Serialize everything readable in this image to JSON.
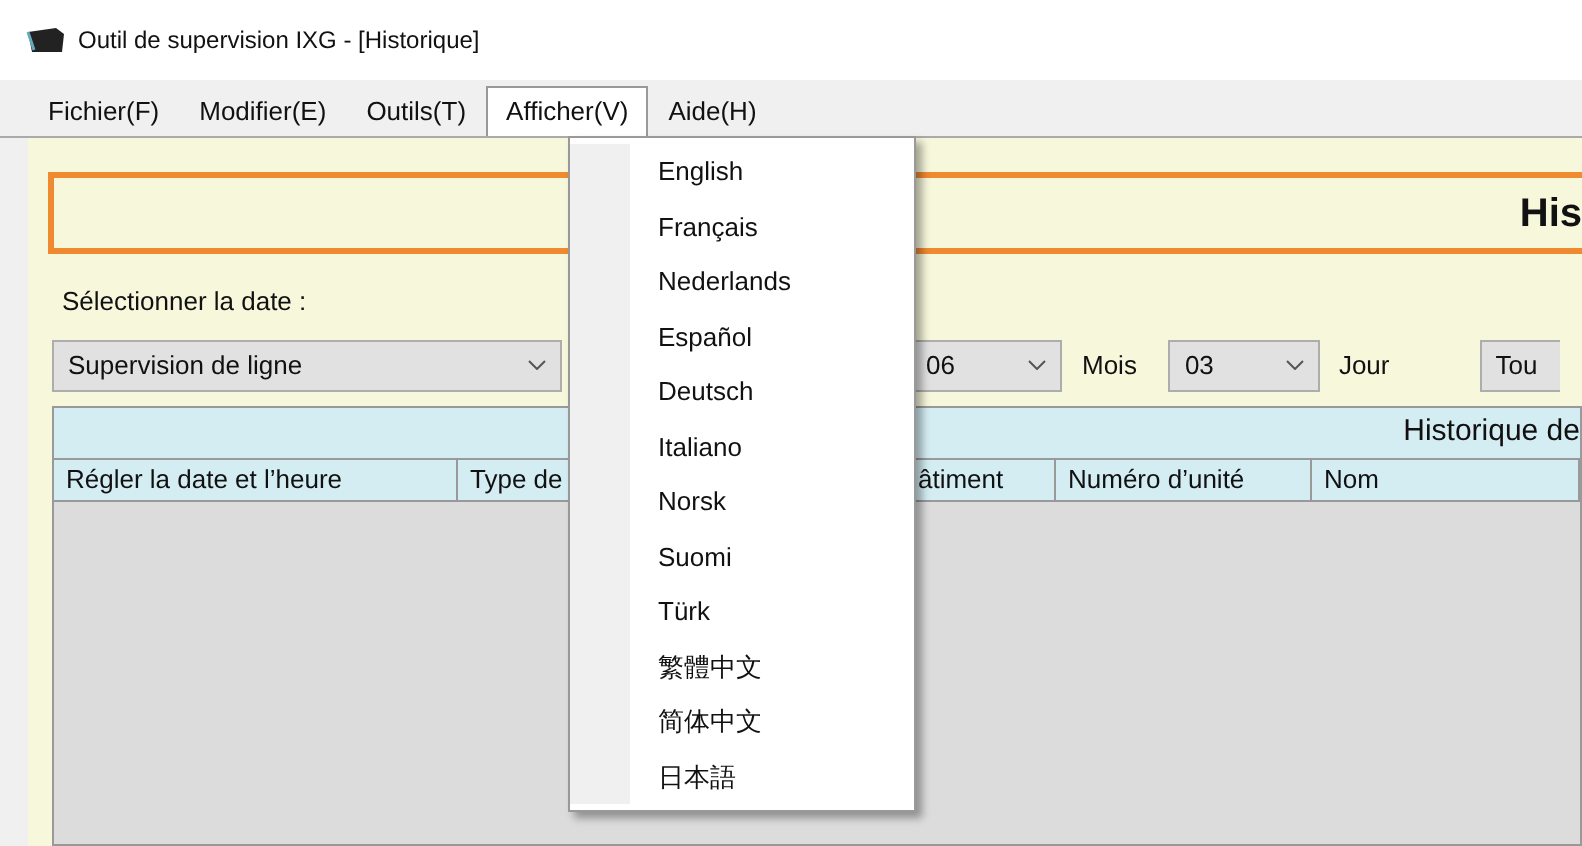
{
  "window": {
    "title": "Outil de supervision IXG - [Historique]"
  },
  "menu_bar": [
    {
      "label": "Fichier(F)",
      "selected": false
    },
    {
      "label": "Modifier(E)",
      "selected": false
    },
    {
      "label": "Outils(T)",
      "selected": false
    },
    {
      "label": "Afficher(V)",
      "selected": true
    },
    {
      "label": "Aide(H)",
      "selected": false
    }
  ],
  "open_menu": {
    "items": [
      "English",
      "Français",
      "Nederlands",
      "Español",
      "Deutsch",
      "Italiano",
      "Norsk",
      "Suomi",
      "Türk",
      "繁體中文",
      "简体中文",
      "日本語"
    ]
  },
  "page_title": "His",
  "date_label": "Sélectionner la date :",
  "filters": [
    {
      "kind": "dropdown",
      "value": "Supervision de ligne"
    },
    {
      "kind": "dropdown",
      "value": "06"
    },
    {
      "kind": "label",
      "text": "Mois"
    },
    {
      "kind": "dropdown",
      "value": "03"
    },
    {
      "kind": "label",
      "text": "Jour"
    },
    {
      "kind": "dropdown",
      "value": "Tou"
    }
  ],
  "table": {
    "title": "Historique de",
    "columns": [
      "Régler la date et l’heure",
      "Type de",
      "âtiment",
      "Numéro d’unité",
      "Nom"
    ]
  }
}
